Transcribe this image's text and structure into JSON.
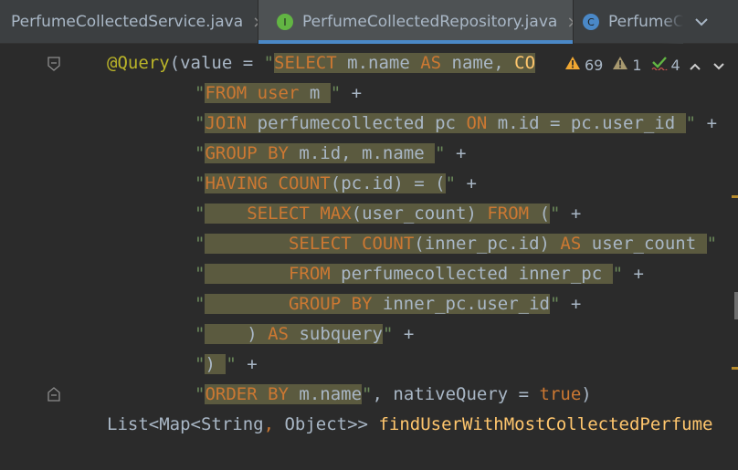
{
  "tabs": [
    {
      "label": "PerfumeCollectedService.java",
      "icon": "class-icon",
      "icon_letter": "",
      "icon_color": "#4a88c7",
      "close": "×"
    },
    {
      "label": "PerfumeCollectedRepository.java",
      "icon": "interface-icon",
      "icon_letter": "I",
      "icon_color": "#62b543",
      "close": "×"
    },
    {
      "label": "PerfumeC",
      "icon": "class-icon",
      "icon_letter": "C",
      "icon_color": "#4a88c7"
    }
  ],
  "tab_overflow_icon": "chevron-down-icon",
  "inspections": {
    "warnings": "69",
    "weak_warnings": "1",
    "typos": "4"
  },
  "colors": {
    "accent": "#4a88c7",
    "selection": "#5b5a3f",
    "keyword": "#cc7832",
    "string": "#6a8759",
    "annotation": "#bbb529",
    "method": "#ffc66d"
  },
  "code": {
    "l1": {
      "ann": "@Query",
      "p1": "(value = ",
      "q": "\"",
      "kw1": "SELECT",
      "t1": " m.name ",
      "kw2": "AS",
      "t2": " name, ",
      "kw3": "CO"
    },
    "l2": {
      "q": "\"",
      "kw1": "FROM",
      "t1": " ",
      "kw2": "user",
      "t2": " m ",
      "q2": "\"",
      "op": " +"
    },
    "l3": {
      "q": "\"",
      "kw1": "JOIN",
      "t1": " perfumecollected pc ",
      "kw2": "ON",
      "t2": " m.id = pc.user_id ",
      "q2": "\"",
      "op": " +"
    },
    "l4": {
      "q": "\"",
      "kw1": "GROUP BY",
      "t1": " m.id, m.name ",
      "q2": "\"",
      "op": " +"
    },
    "l5": {
      "q": "\"",
      "kw1": "HAVING",
      "t1": " ",
      "kw2": "COUNT",
      "t2": "(pc.id) = (",
      "q2": "\"",
      "op": " +"
    },
    "l6": {
      "q": "\"",
      "pad": "    ",
      "kw1": "SELECT",
      "t1": " ",
      "kw2": "MAX",
      "t2": "(user_count) ",
      "kw3": "FROM",
      "t3": " (",
      "q2": "\"",
      "op": " +"
    },
    "l7": {
      "q": "\"",
      "pad": "        ",
      "kw1": "SELECT",
      "t1": " ",
      "kw2": "COUNT",
      "t2": "(inner_pc.id) ",
      "kw3": "AS",
      "t3": " user_count ",
      "q2": "\""
    },
    "l8": {
      "q": "\"",
      "pad": "        ",
      "kw1": "FROM",
      "t1": " perfumecollected inner_pc ",
      "q2": "\"",
      "op": " +"
    },
    "l9": {
      "q": "\"",
      "pad": "        ",
      "kw1": "GROUP BY",
      "t1": " inner_pc.user_id",
      "q2": "\"",
      "op": " +"
    },
    "l10": {
      "q": "\"",
      "pad": "    ",
      "t1": ") ",
      "kw1": "AS",
      "t2": " subquery",
      "q2": "\"",
      "op": " +"
    },
    "l11": {
      "q": "\"",
      "t1": ") ",
      "q2": "\"",
      "op": " +"
    },
    "l12": {
      "q": "\"",
      "kw1": "ORDER BY",
      "t1": " m.name",
      "q2": "\"",
      "p1": ", nativeQuery = ",
      "kw2": "true",
      "p2": ")"
    },
    "l13": {
      "p1": "List<Map<String",
      "comma": ",",
      "p2": " Object>> ",
      "fn": "findUserWithMostCollectedPerfume"
    }
  }
}
